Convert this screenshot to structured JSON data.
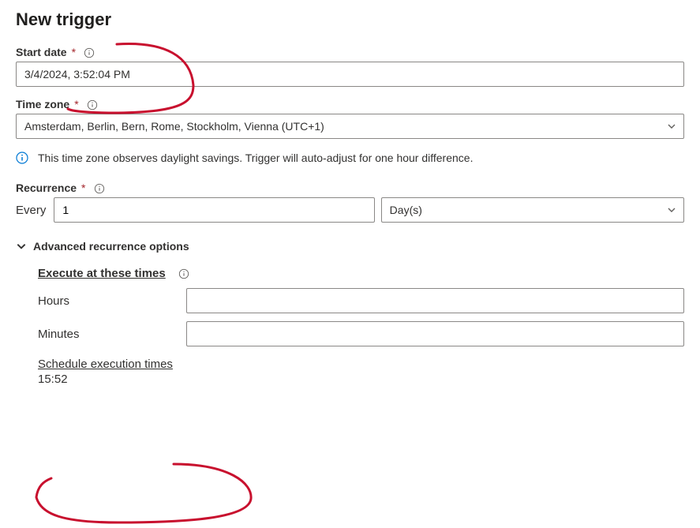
{
  "title": "New trigger",
  "startDate": {
    "label": "Start date",
    "value": "3/4/2024, 3:52:04 PM"
  },
  "timeZone": {
    "label": "Time zone",
    "value": "Amsterdam, Berlin, Bern, Rome, Stockholm, Vienna (UTC+1)"
  },
  "dstMessage": "This time zone observes daylight savings. Trigger will auto-adjust for one hour difference.",
  "recurrence": {
    "label": "Recurrence",
    "everyLabel": "Every",
    "everyValue": "1",
    "unit": "Day(s)"
  },
  "advanced": {
    "toggleLabel": "Advanced recurrence options",
    "executeAtLabel": "Execute at these times",
    "hoursLabel": "Hours",
    "hoursValue": "",
    "minutesLabel": "Minutes",
    "minutesValue": "",
    "scheduleLabel": "Schedule execution times",
    "scheduleValue": "15:52"
  }
}
